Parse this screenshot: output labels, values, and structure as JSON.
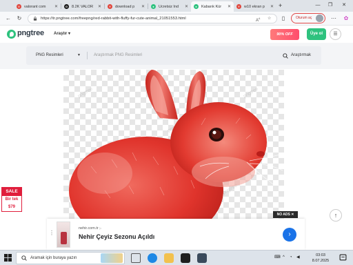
{
  "browser": {
    "tabs": [
      {
        "label": "valorant com",
        "favicon_color": "#e0463c",
        "active": false
      },
      {
        "label": "8.2K VALOR",
        "favicon_color": "#1a1a1a",
        "active": false
      },
      {
        "label": "download p",
        "favicon_color": "#e0463c",
        "active": false
      },
      {
        "label": "Ücretsiz İnd",
        "favicon_color": "#2ec27e",
        "active": false
      },
      {
        "label": "Kabarık Kür",
        "favicon_color": "#2ec27e",
        "active": true
      },
      {
        "label": "w10 ekran p",
        "favicon_color": "#e0463c",
        "active": false
      }
    ],
    "new_tab": "+",
    "url": "https://tr.pngtree.com/freepng/red-rabbit-with-fluffy-fur-cute-animal_21051553.html",
    "signin_label": "Oturum aç",
    "window_controls": {
      "minimize": "—",
      "maximize": "❐",
      "close": "✕"
    }
  },
  "site": {
    "logo": "pngtree",
    "explore_label": "Araştır ▾",
    "promo_label": "90% OFF",
    "member_label": "Üye ol",
    "menu_label": "☰"
  },
  "search": {
    "type_label": "PNG Resimleri",
    "caret": "▼",
    "placeholder": "Araştırmak PNG Resimleri",
    "button_label": "Araştırmak"
  },
  "watermark": "pngtree",
  "side_ad": {
    "badge": "SALE",
    "line1": "Bir tek",
    "line2": "$79"
  },
  "noads_label": "NO ADS ✕",
  "scroll_top": "↑",
  "bottom_ad": {
    "source": "nehir.com.tr",
    "title": "Nehir Çeyiz Sezonu Açıldı",
    "dots": "⋮",
    "arrow": "›"
  },
  "taskbar": {
    "search_placeholder": "Aramak için buraya yazın",
    "time": "03:03",
    "date": "8.07.2025",
    "tray_chevron": "^",
    "tray_lang": "⌨"
  },
  "colors": {
    "brand_green": "#2ec27e",
    "promo_red": "#ff4d6d",
    "rabbit_red": "#e0342c"
  }
}
